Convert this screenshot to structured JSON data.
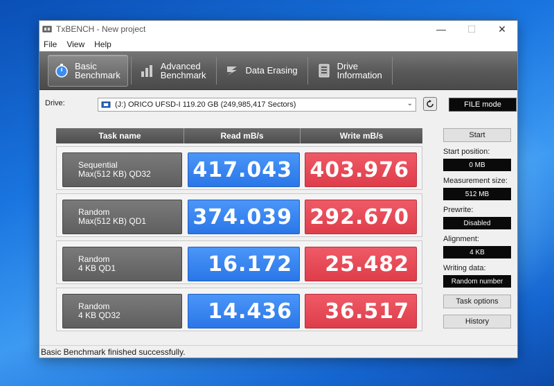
{
  "window": {
    "title": "TxBENCH - New project",
    "controls": {
      "minimize": "—",
      "maximize": "☐",
      "close": "✕"
    }
  },
  "menu": [
    "File",
    "View",
    "Help"
  ],
  "toolbar": {
    "tabs": [
      {
        "line1": "Basic",
        "line2": "Benchmark",
        "icon": "stopwatch-icon",
        "active": true
      },
      {
        "line1": "Advanced",
        "line2": "Benchmark",
        "icon": "bar-chart-icon",
        "active": false
      },
      {
        "line1": "Data Erasing",
        "line2": "",
        "icon": "eraser-icon",
        "active": false
      },
      {
        "line1": "Drive",
        "line2": "Information",
        "icon": "drive-info-icon",
        "active": false
      }
    ]
  },
  "drive": {
    "label": "Drive:",
    "selected": "(J:) ORICO UFSD-I  119.20 GB (249,985,417 Sectors)",
    "mode": "FILE mode"
  },
  "grid": {
    "headers": {
      "name": "Task name",
      "read": "Read mB/s",
      "write": "Write mB/s"
    },
    "rows": [
      {
        "name1": "Sequential",
        "name2": "Max(512 KB) QD32",
        "read": "417.043",
        "write": "403.976"
      },
      {
        "name1": "Random",
        "name2": "Max(512 KB) QD1",
        "read": "374.039",
        "write": "292.670"
      },
      {
        "name1": "Random",
        "name2": "4 KB QD1",
        "read": "16.172",
        "write": "25.482"
      },
      {
        "name1": "Random",
        "name2": "4 KB QD32",
        "read": "14.436",
        "write": "36.517"
      }
    ]
  },
  "side": {
    "start": "Start",
    "start_position_label": "Start position:",
    "start_position_value": "0 MB",
    "measurement_size_label": "Measurement size:",
    "measurement_size_value": "512 MB",
    "prewrite_label": "Prewrite:",
    "prewrite_value": "Disabled",
    "alignment_label": "Alignment:",
    "alignment_value": "4 KB",
    "writing_data_label": "Writing data:",
    "writing_data_value": "Random number",
    "task_options": "Task options",
    "history": "History"
  },
  "status": "Basic Benchmark finished successfully.",
  "colors": {
    "read": "#2f7ff0",
    "write": "#e34552",
    "toolbar": "#5a5a5a"
  }
}
